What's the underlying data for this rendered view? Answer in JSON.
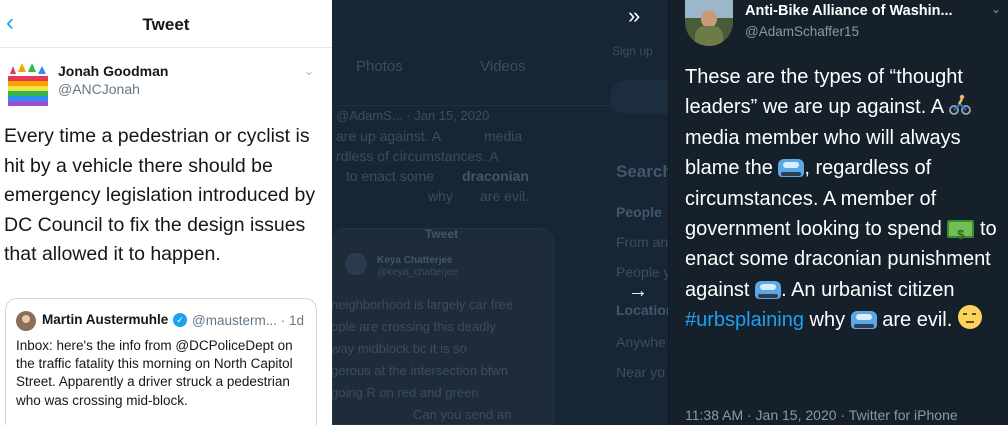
{
  "left": {
    "nav_title": "Tweet",
    "author": {
      "name": "Jonah Goodman",
      "handle": "@ANCJonah"
    },
    "tweet_text": "Every time a pedestrian or cyclist is hit by a vehicle there should be emergency legislation introduced by DC Council to fix the design issues that allowed it to happen.",
    "quote": {
      "name": "Martin Austermuhle",
      "handle": "@mausterm...",
      "time": "· 1d",
      "text": "Inbox: here's the info from @DCPoliceDept on the traffic fatality this morning on North Capitol Street. Apparently a driver struck a pedestrian who was crossing mid-block."
    }
  },
  "middle": {
    "tabs": [
      "Photos",
      "Videos"
    ],
    "tweet_lines": [
      "@AdamS... · Jan 15, 2020",
      "are up against. A",
      "media",
      "rdless of circumstances. A",
      "to enact some",
      "draconian",
      "why",
      "are evil."
    ],
    "panel": {
      "title": "Tweet",
      "author": "Keya Chatterjee",
      "handle": "@keya_chatterjee",
      "lines": [
        "neighborhood is largely car free",
        "ople are crossing this deadly",
        "way midblock bc it is so",
        "gerous at the intersection btwn",
        "going R on red and green",
        "Can you send an"
      ]
    },
    "right": {
      "signup": "Sign up",
      "search_title": "Search",
      "people": "People",
      "from": "From an",
      "people_you": "People y",
      "location": "Location",
      "anywhere": "Anywhe",
      "near": "Near yo"
    }
  },
  "right": {
    "name": "Anti-Bike Alliance of Washin...",
    "handle": "@AdamSchaffer15",
    "text": {
      "p1": "These are the types of “thought leaders” we are up against. A",
      "p2": "media member who will always blame the",
      "p3": ", regardless of circumstances. A member of government looking to spend",
      "p4": "to enact some draconian punishment against",
      "p5": ". An urbanist citizen",
      "hashtag": "#urbsplaining",
      "p6": "why",
      "p7": "are evil."
    },
    "meta": "11:38 AM · Jan 15, 2020 · Twitter for iPhone"
  },
  "icons": {
    "nav_back": "chevron-left-icon",
    "collapse": "double-chevron-right-icon",
    "next": "arrow-right-icon"
  }
}
